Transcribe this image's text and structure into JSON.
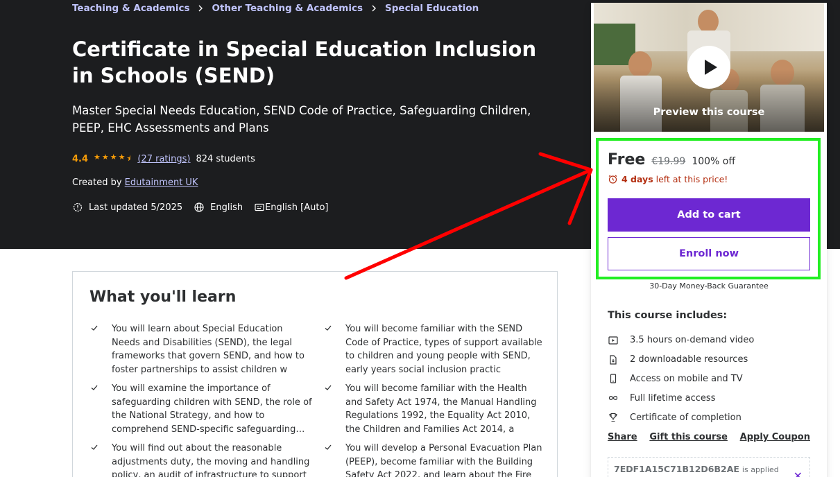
{
  "breadcrumb": [
    "Teaching & Academics",
    "Other Teaching & Academics",
    "Special Education"
  ],
  "course": {
    "title": "Certificate in Special Education Inclusion in Schools (SEND)",
    "subtitle": "Master Special Needs Education, SEND Code of Practice, Safeguarding Children, PEEP, EHC Assessments and Plans",
    "rating": "4.4",
    "stars": 4.4,
    "ratings_link": "(27 ratings)",
    "students": "824 students",
    "created_by_label": "Created by",
    "instructor": "Edutainment UK",
    "last_updated": "Last updated 5/2025",
    "language": "English",
    "captions": "English [Auto]"
  },
  "learn": {
    "heading": "What you'll learn",
    "items": [
      "You will learn about Special Education Needs and Disabilities (SEND), the legal frameworks that govern SEND, and how to foster partnerships to assist children w",
      "You will become familiar with the SEND Code of Practice, types of support available to children and young people with SEND, early years social inclusion practic",
      "You will examine the importance of safeguarding children with SEND, the role of the National Strategy, and how to comprehend SEND-specific safeguarding…",
      "You will become familiar with the Health and Safety Act 1974, the Manual Handling Regulations 1992, the Equality Act 2010, the Children and Families Act 2014, a",
      "You will find out about the reasonable adjustments duty, the moving and handling policy, an audit of infrastructure to support",
      "You will develop a Personal Evacuation Plan (PEEP), become familiar with the Building Safety Act 2022, and learn about the Fire"
    ]
  },
  "sidebar": {
    "preview_label": "Preview this course",
    "price_free": "Free",
    "price_original": "€19.99",
    "discount": "100% off",
    "timer_bold": "4 days",
    "timer_rest": "left at this price!",
    "add_to_cart": "Add to cart",
    "enroll_now": "Enroll now",
    "guarantee": "30-Day Money-Back Guarantee",
    "includes_title": "This course includes:",
    "includes": [
      {
        "icon": "video-icon",
        "label": "3.5 hours on-demand video"
      },
      {
        "icon": "file-download-icon",
        "label": "2 downloadable resources"
      },
      {
        "icon": "mobile-icon",
        "label": "Access on mobile and TV"
      },
      {
        "icon": "infinity-icon",
        "label": "Full lifetime access"
      },
      {
        "icon": "trophy-icon",
        "label": "Certificate of completion"
      }
    ],
    "links": {
      "share": "Share",
      "gift": "Gift this course",
      "coupon": "Apply Coupon"
    },
    "coupon_code": "7EDF1A15C71B12D6B2AE",
    "coupon_applied": "is applied"
  },
  "colors": {
    "hero_bg": "#1c1d1f",
    "link_purple_light": "#c0c4fc",
    "brand_purple": "#6d28d2",
    "star_orange": "#f69c08",
    "timer_red": "#b32d0f",
    "annotation_green": "#22ee22",
    "annotation_red": "#ff0000"
  }
}
